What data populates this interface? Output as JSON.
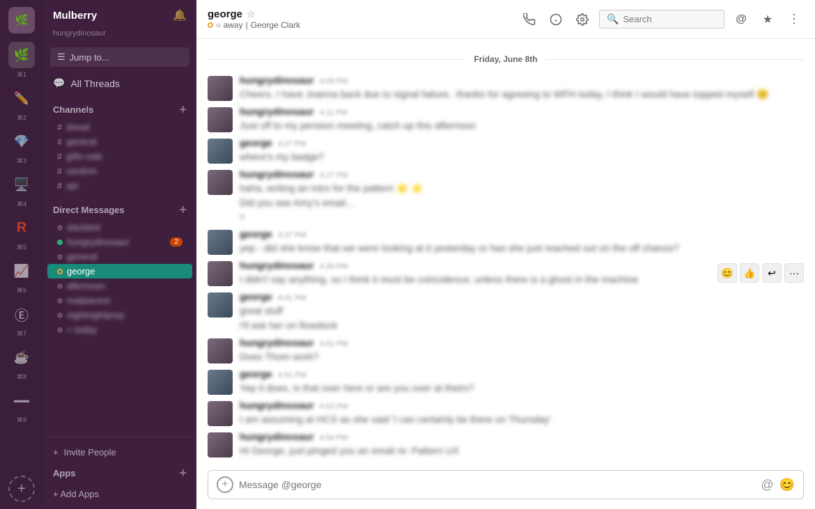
{
  "workspace": {
    "name": "Mulberry",
    "icon": "🌿"
  },
  "app_icons": [
    {
      "id": "1",
      "label": "⌘1",
      "symbol": "🌿",
      "active": true
    },
    {
      "id": "2",
      "label": "⌘2",
      "symbol": "✏️",
      "active": false
    },
    {
      "id": "3",
      "label": "⌘3",
      "symbol": "💎",
      "active": false
    },
    {
      "id": "4",
      "label": "⌘4",
      "symbol": "🖥️",
      "active": false
    },
    {
      "id": "5",
      "label": "⌘5",
      "symbol": "R",
      "active": false
    },
    {
      "id": "6",
      "label": "⌘6",
      "symbol": "📈",
      "active": false
    },
    {
      "id": "7",
      "label": "⌘7",
      "symbol": "Ⓔ",
      "active": false
    },
    {
      "id": "8",
      "label": "⌘8",
      "symbol": "☕",
      "active": false
    },
    {
      "id": "9",
      "label": "⌘9",
      "symbol": "▬",
      "active": false
    }
  ],
  "sidebar": {
    "workspace_name": "Mulberry",
    "jump_to_label": "Jump to...",
    "all_threads_label": "All Threads",
    "channels_label": "Channels",
    "direct_messages_label": "Direct Messages",
    "channels": [
      {
        "name": "dread",
        "prefix": "#",
        "active": false
      },
      {
        "name": "general",
        "prefix": "#",
        "active": false
      },
      {
        "name": "gifts-sale",
        "prefix": "#",
        "active": false
      },
      {
        "name": "random",
        "prefix": "#",
        "active": false
      },
      {
        "name": "api",
        "prefix": "#",
        "active": false
      }
    ],
    "direct_messages": [
      {
        "name": "slackbot",
        "online": false,
        "away": false
      },
      {
        "name": "hungrydinosaur",
        "online": true,
        "away": false,
        "badge": "2 unread"
      },
      {
        "name": "general",
        "online": false,
        "away": false
      },
      {
        "name": "george",
        "online": false,
        "away": true,
        "active": true
      }
    ],
    "invite_people_label": "Invite People",
    "apps_label": "Apps",
    "add_apps_label": "+ Add Apps"
  },
  "channel": {
    "name": "george",
    "status": "away",
    "full_name": "George Clark",
    "star_label": "star",
    "search_placeholder": "Search"
  },
  "date_divider": "Friday, June 8th",
  "messages": [
    {
      "id": "m1",
      "author": "hungrydinosaur",
      "time": "4:09 PM",
      "text": "Cheers. I have Joanna back due to signal failure.. thanks for agreeing to WFH today, I think I would have topped myself 😊",
      "avatar": "1",
      "blurred": true
    },
    {
      "id": "m2",
      "author": "hungrydinosaur",
      "time": "4:11 PM",
      "text": "Just off to my pension meeting, catch up this afternoon",
      "avatar": "1",
      "blurred": true
    },
    {
      "id": "m3",
      "author": "george",
      "time": "4:27 PM",
      "text": "where's my badge?",
      "avatar": "2",
      "blurred": true
    },
    {
      "id": "m4",
      "author": "hungrydinosaur",
      "time": "4:27 PM",
      "text": "haha, writing an intro for the pattern 🌟 ⭐",
      "avatar": "1",
      "blurred": true
    },
    {
      "id": "m4b",
      "author": "hungrydinosaur",
      "time": "",
      "text": "Did you see Amy's email...",
      "avatar": "1",
      "blurred": true,
      "continuation": true
    },
    {
      "id": "m5",
      "author": "george",
      "time": "4:37 PM",
      "text": "yep - did she know that we were looking at it yesterday or has she just reached out on the off chance?",
      "avatar": "2",
      "blurred": true
    },
    {
      "id": "m6",
      "author": "hungrydinosaur",
      "time": "4:39 PM",
      "text": "I didn't say anything, so I think it must be coincidence, unless there is a ghost in the machine",
      "avatar": "1",
      "blurred": true,
      "has_reactions": true
    },
    {
      "id": "m7",
      "author": "george",
      "time": "4:41 PM",
      "text": "great stuff",
      "avatar": "2",
      "blurred": true
    },
    {
      "id": "m7b",
      "author": "george",
      "time": "",
      "text": "I'll ask her on flowdock",
      "avatar": "2",
      "blurred": true,
      "continuation": true
    },
    {
      "id": "m8",
      "author": "hungrydinosaur",
      "time": "4:51 PM",
      "text": "Does Thom work?",
      "avatar": "1",
      "blurred": true
    },
    {
      "id": "m9",
      "author": "george",
      "time": "4:51 PM",
      "text": "Yep it does, is that over here or are you over at theirs?",
      "avatar": "2",
      "blurred": true
    },
    {
      "id": "m10",
      "author": "hungrydinosaur",
      "time": "4:53 PM",
      "text": "I am assuming at HCS as she said 'I can certainly be there on Thursday'",
      "avatar": "1",
      "blurred": true
    },
    {
      "id": "m11",
      "author": "hungrydinosaur",
      "time": "4:54 PM",
      "text": "Hi George, just pinged you an email re: Pattern UX",
      "avatar": "1",
      "blurred": true
    }
  ],
  "message_input": {
    "placeholder": "Message @george"
  }
}
